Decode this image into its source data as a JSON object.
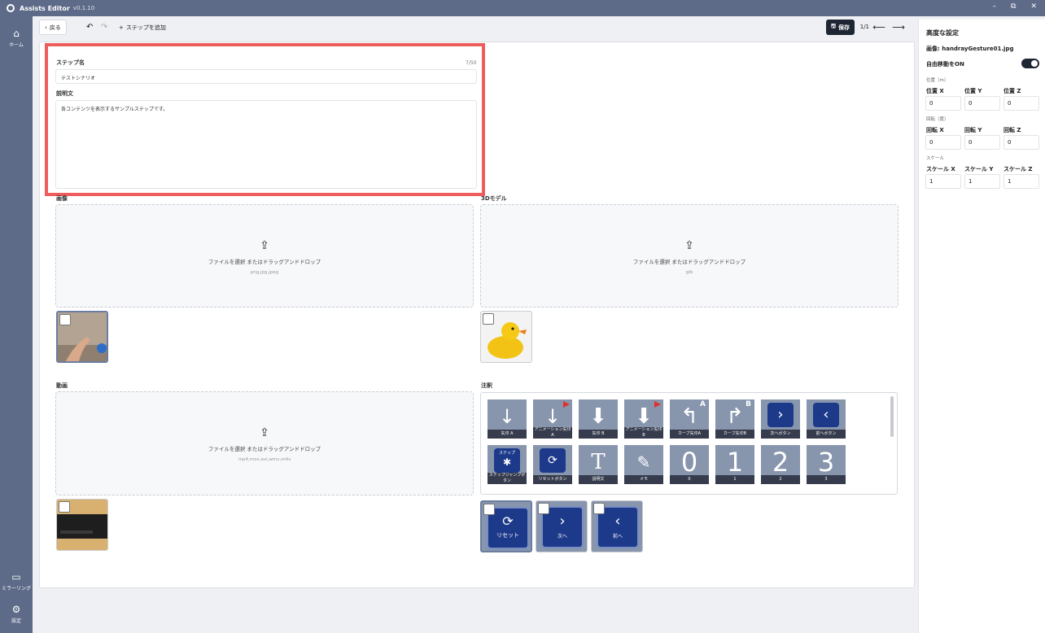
{
  "app": {
    "title": "Assists Editor",
    "version": "v0.1.10"
  },
  "window": {
    "minimize": "–",
    "maximize": "⧉",
    "close": "✕"
  },
  "sidebar": {
    "home": "ホーム",
    "mirroring": "ミラーリング",
    "settings": "設定"
  },
  "toolbar": {
    "back": "戻る",
    "undo": "↶",
    "redo": "↷",
    "add_step": "ステップを追加",
    "save": "保存",
    "page": "1/1",
    "prev": "⟵",
    "next": "⟶"
  },
  "form": {
    "step_name_label": "ステップ名",
    "step_name_count": "7/50",
    "step_name_value": "テストシナリオ",
    "description_label": "説明文",
    "description_value": "各コンテンツを表示するサンプルステップです。"
  },
  "image_section": {
    "label": "画像",
    "drop_text": "ファイルを選択 またはドラッグアンドドロップ",
    "drop_types": "png,jpg,jpeg"
  },
  "model_section": {
    "label": "3Dモデル",
    "drop_text": "ファイルを選択 またはドラッグアンドドロップ",
    "drop_types": "glb"
  },
  "video_section": {
    "label": "動画",
    "drop_text": "ファイルを選択 またはドラッグアンドドロップ",
    "drop_types": "mp4,mov,avi,wmv,m4v"
  },
  "annotation_section": {
    "label": "注釈",
    "tiles_row1": [
      "矢印 A",
      "アニメーション矢印 A",
      "矢印 B",
      "アニメーション矢印 B",
      "カーブ矢印A",
      "カーブ矢印B",
      "次へボタン",
      "前へボタン"
    ],
    "tiles_row2": [
      "ステップジャンプボタン",
      "リセットボタン",
      "説明文",
      "メモ",
      "0",
      "1",
      "2",
      "3"
    ],
    "jump_top": "ステップ",
    "selected": [
      "リセット",
      "次へ",
      "前へ"
    ]
  },
  "right_panel": {
    "title": "高度な設定",
    "image_file": "画像: handrayGesture01.jpg",
    "free_move": "自由移動をON",
    "position_section": "位置（m）",
    "pos_x_label": "位置 X",
    "pos_y_label": "位置 Y",
    "pos_z_label": "位置 Z",
    "pos_x": "0",
    "pos_y": "0",
    "pos_z": "0",
    "rotation_section": "回転（度）",
    "rot_x_label": "回転 X",
    "rot_y_label": "回転 Y",
    "rot_z_label": "回転 Z",
    "rot_x": "0",
    "rot_y": "0",
    "rot_z": "0",
    "scale_section": "スケール",
    "scale_x_label": "スケール X",
    "scale_y_label": "スケール Y",
    "scale_z_label": "スケール Z",
    "scale_x": "1",
    "scale_y": "1",
    "scale_z": "1"
  },
  "colors": {
    "sidebar": "#5d6a88",
    "highlight": "#ef5c5c",
    "tile": "#8795ad",
    "button_blue": "#1d3a8a"
  }
}
